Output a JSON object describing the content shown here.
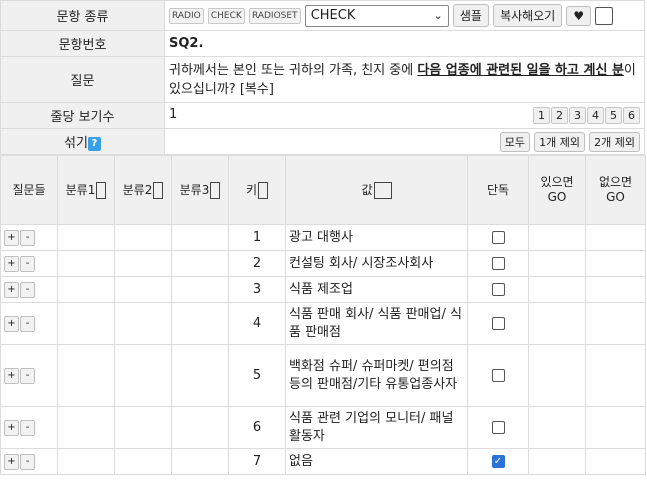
{
  "form": {
    "type_label": "문항 종류",
    "type_buttons": [
      "RADIO",
      "CHECK",
      "RADIOSET"
    ],
    "type_select_value": "CHECK",
    "sample_label": "샘플",
    "copy_label": "복사해오기",
    "heart_glyph": "♥",
    "number_label": "문항번호",
    "number_value": "SQ2.",
    "question_label": "질문",
    "question_pre": "귀하께서는 본인 또는 귀하의 가족, 친지 중에 ",
    "question_emph": "다음 업종에 관련된 일을 하고 계신 분",
    "question_post": "이 있으십니까? [복수]",
    "perline_label": "줄당 보기수",
    "perline_value": "1",
    "perline_buttons": [
      "1",
      "2",
      "3",
      "4",
      "5",
      "6"
    ],
    "shuffle_label": "섞기",
    "help_glyph": "?",
    "shuffle_buttons": [
      "모두",
      "1개 제외",
      "2개 제외"
    ]
  },
  "grid": {
    "headers": {
      "question": "질문들",
      "cat1": "분류1",
      "cat2": "분류2",
      "cat3": "분류3",
      "key": "키",
      "value": "값",
      "solo": "단독",
      "go_yes": "있으면 GO",
      "go_no": "없으면 GO"
    },
    "plus": "+",
    "minus": "-",
    "rows": [
      {
        "key": "1",
        "value": "광고 대행사",
        "solo": false
      },
      {
        "key": "2",
        "value": "컨설팅 회사/ 시장조사회사",
        "solo": false
      },
      {
        "key": "3",
        "value": "식품 제조업",
        "solo": false
      },
      {
        "key": "4",
        "value": "식품 판매 회사/ 식품 판매업/ 식품 판매점",
        "solo": false
      },
      {
        "key": "5",
        "value": "백화점 슈퍼/ 슈퍼마켓/ 편의점 등의 판매점/기타 유통업종사자",
        "solo": false
      },
      {
        "key": "6",
        "value": "식품 관련 기업의 모니터/ 패널 활동자",
        "solo": false
      },
      {
        "key": "7",
        "value": "없음",
        "solo": true
      }
    ]
  }
}
